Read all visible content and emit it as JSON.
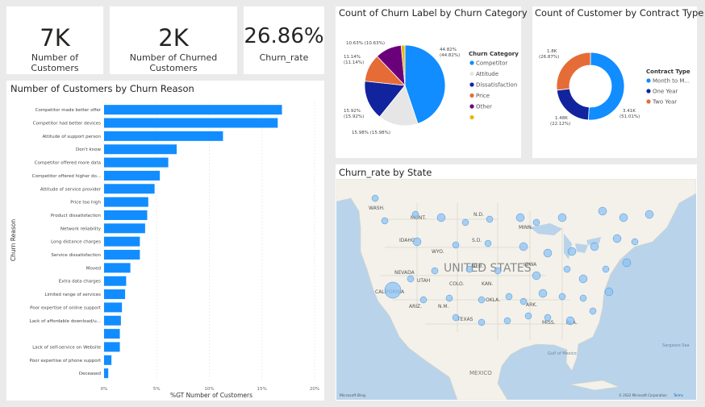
{
  "kpis": [
    {
      "value": "7K",
      "label": "Number of Customers"
    },
    {
      "value": "2K",
      "label": "Number of Churned Customers"
    },
    {
      "value": "26.86%",
      "label": "Churn_rate"
    }
  ],
  "bar_chart": {
    "title": "Number of Customers by Churn Reason",
    "ylabel": "Churn Reason",
    "xlabel": "%GT Number of Customers",
    "x_ticks": [
      "0%",
      "5%",
      "10%",
      "15%",
      "20%"
    ]
  },
  "pie_chart": {
    "title": "Count of Churn Label by Churn Category",
    "legend_title": "Churn Category",
    "data_labels": {
      "competitor": "44.82%\n(44.82%)",
      "dissatisfaction": "15.92%\n(15.92%)",
      "attitude": "15.98% (15.98%)",
      "price": "11.14%\n(11.14%)",
      "other": "10.63% (10.63%)"
    }
  },
  "donut_chart": {
    "title": "Count of Customer by Contract Type",
    "legend_title": "Contract Type",
    "data_labels": {
      "month": "3.41K\n(51.01%)",
      "one_year": "1.48K\n(22.12%)",
      "two_year": "1.8K\n(26.87%)"
    }
  },
  "map": {
    "title": "Churn_rate by State",
    "country_label": "UNITED STATES",
    "mexico_label": "MEXICO",
    "gulf_label": "Gulf of Mexico",
    "sea_label": "Sargasso Sea",
    "state_labels": [
      "WASH.",
      "MONT.",
      "N.D.",
      "MINN.",
      "S.D.",
      "IDAHO",
      "WYO.",
      "NEB.",
      "IOWA",
      "NEVADA",
      "UTAH",
      "COLO.",
      "KAN.",
      "CALIFORNIA",
      "ARIZ.",
      "N.M.",
      "OKLA.",
      "ARK.",
      "TEXAS",
      "MISS.",
      "ALA."
    ],
    "brand": "Microsoft Bing",
    "copyright": "© 2022 Microsoft Corporation",
    "terms": "Terms"
  },
  "chart_data": [
    {
      "type": "bar",
      "title": "Number of Customers by Churn Reason",
      "xlabel": "%GT Number of Customers",
      "ylabel": "Churn Reason",
      "xlim": [
        0,
        20
      ],
      "orientation": "horizontal",
      "categories": [
        "Competitor made better offer",
        "Competitor had better devices",
        "Attitude of support person",
        "Don't know",
        "Competitor offered more data",
        "Competitor offered higher do...",
        "Attitude of service provider",
        "Price too high",
        "Product dissatisfaction",
        "Network reliability",
        "Long distance charges",
        "Service dissatisfaction",
        "Moved",
        "Extra data charges",
        "Limited range of services",
        "Poor expertise of online support",
        "Lack of affordable download/u...",
        "",
        "Lack of self-service on Website",
        "Poor expertise of phone support",
        "Deceased"
      ],
      "values": [
        16.9,
        16.5,
        11.3,
        6.9,
        6.1,
        5.3,
        4.8,
        4.2,
        4.1,
        3.9,
        3.4,
        3.4,
        2.5,
        2.1,
        2.0,
        1.7,
        1.6,
        1.5,
        1.5,
        0.7,
        0.4
      ],
      "color": "#118DFF"
    },
    {
      "type": "pie",
      "title": "Count of Churn Label by Churn Category",
      "categories": [
        "Competitor",
        "Attitude",
        "Dissatisfaction",
        "Price",
        "Other",
        ""
      ],
      "values": [
        44.82,
        15.98,
        15.92,
        11.14,
        10.63,
        1.51
      ],
      "colors": [
        "#118DFF",
        "#E6E6E6",
        "#12239E",
        "#E66C37",
        "#6B007B",
        "#E8B60E"
      ]
    },
    {
      "type": "pie",
      "donut": true,
      "title": "Count of Customer by Contract Type",
      "categories": [
        "Month to M...",
        "One Year",
        "Two Year"
      ],
      "values": [
        51.01,
        22.12,
        26.87
      ],
      "counts_k": [
        3.41,
        1.48,
        1.8
      ],
      "colors": [
        "#118DFF",
        "#12239E",
        "#E66C37"
      ]
    }
  ]
}
